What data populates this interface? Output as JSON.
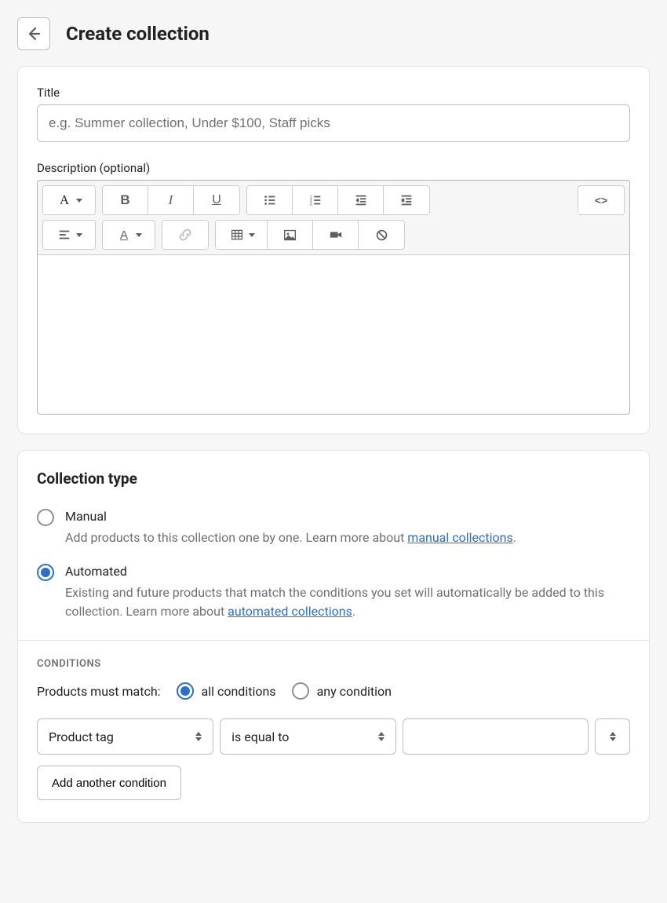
{
  "header": {
    "title": "Create collection"
  },
  "title_field": {
    "label": "Title",
    "value": "",
    "placeholder": "e.g. Summer collection, Under $100, Staff picks"
  },
  "description": {
    "label": "Description (optional)",
    "value": ""
  },
  "collection_type": {
    "heading": "Collection type",
    "manual": {
      "label": "Manual",
      "desc_prefix": "Add products to this collection one by one. Learn more about ",
      "link_text": "manual collections",
      "desc_suffix": ".",
      "selected": false
    },
    "automated": {
      "label": "Automated",
      "desc_prefix": "Existing and future products that match the conditions you set will automatically be added to this collection. Learn more about ",
      "link_text": "automated collections",
      "desc_suffix": ".",
      "selected": true
    }
  },
  "conditions": {
    "heading": "CONDITIONS",
    "match_label": "Products must match:",
    "all_label": "all conditions",
    "any_label": "any condition",
    "match_all_selected": true,
    "rule": {
      "field": "Product tag",
      "operator": "is equal to",
      "value": ""
    },
    "add_label": "Add another condition"
  }
}
